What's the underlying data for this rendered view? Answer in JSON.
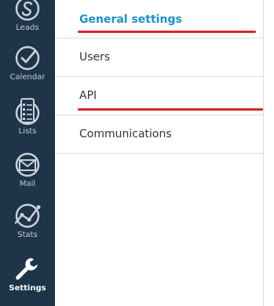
{
  "sidebar": {
    "items": [
      {
        "label": "Leads",
        "icon": "leads-icon"
      },
      {
        "label": "Calendar",
        "icon": "calendar-check-icon"
      },
      {
        "label": "Lists",
        "icon": "lists-icon"
      },
      {
        "label": "Mail",
        "icon": "mail-icon"
      },
      {
        "label": "Stats",
        "icon": "stats-icon"
      },
      {
        "label": "Settings",
        "icon": "wrench-icon",
        "active": true
      }
    ]
  },
  "settings_menu": {
    "items": [
      {
        "label": "General settings",
        "active": true
      },
      {
        "label": "Users"
      },
      {
        "label": "API"
      },
      {
        "label": "Communications"
      }
    ]
  },
  "colors": {
    "sidebar_bg": "#1e3448",
    "active_link": "#1e8fc9",
    "annotation_red": "#d4262f"
  }
}
